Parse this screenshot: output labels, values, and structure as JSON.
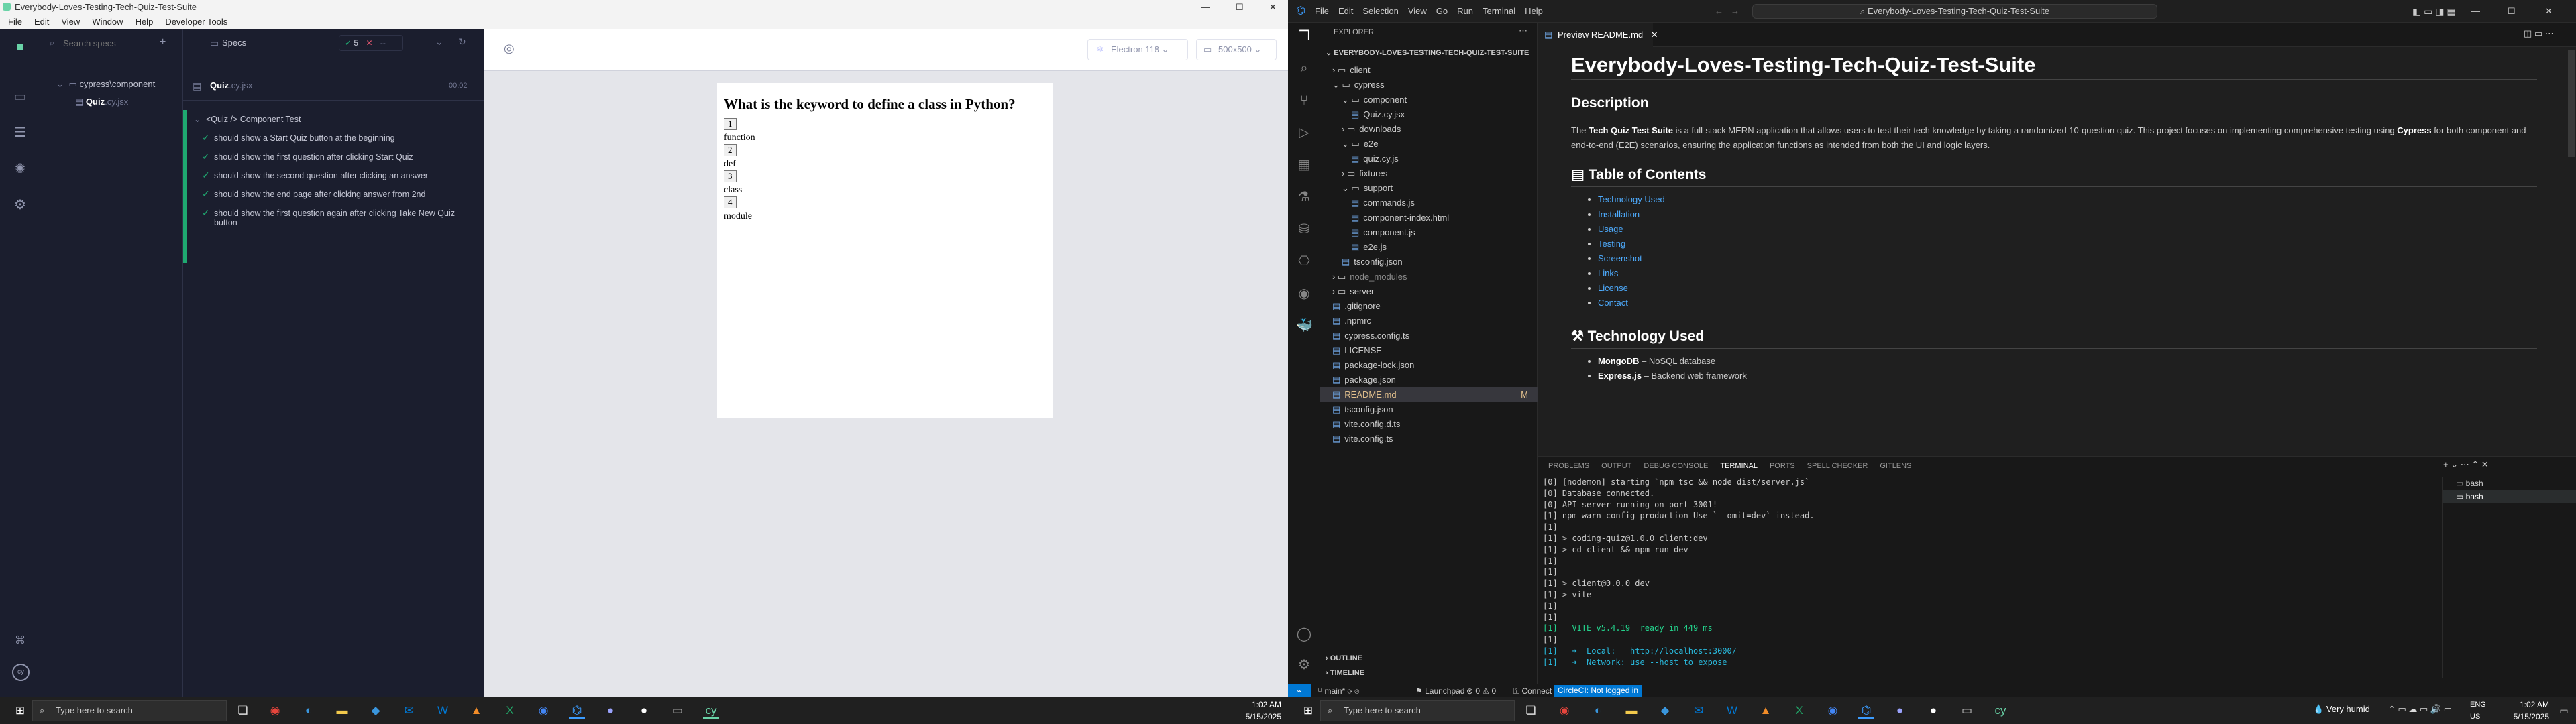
{
  "cypress": {
    "window_title": "Everybody-Loves-Testing-Tech-Quiz-Test-Suite",
    "menu": [
      "File",
      "Edit",
      "View",
      "Window",
      "Help",
      "Developer Tools"
    ],
    "specs_header": "Specs",
    "search_placeholder": "Search specs",
    "folder": "cypress\\component",
    "spec_file": "Quiz",
    "spec_ext": ".cy.jsx",
    "pass_count": "5",
    "fail_count": "✕",
    "pending": "--",
    "runner_spec_name": "Quiz",
    "runner_spec_ext": ".cy.jsx",
    "duration": "00:02",
    "suite": "<Quiz /> Component Test",
    "tests": [
      "should show a Start Quiz button at the beginning",
      "should show the first question after clicking Start Quiz",
      "should show the second question after clicking an answer",
      "should show the end page after clicking answer from 2nd",
      "should show the first question again after clicking Take New Quiz button"
    ],
    "browser": "Electron 118",
    "viewport": "500x500",
    "question": "What is the keyword to define a class in Python?",
    "answers": [
      {
        "num": "1",
        "text": "function"
      },
      {
        "num": "2",
        "text": "def"
      },
      {
        "num": "3",
        "text": "class"
      },
      {
        "num": "4",
        "text": "module"
      }
    ]
  },
  "vscode": {
    "menu": [
      "File",
      "Edit",
      "Selection",
      "View",
      "Go",
      "Run",
      "Terminal",
      "Help"
    ],
    "search": "Everybody-Loves-Testing-Tech-Quiz-Test-Suite",
    "explorer_title": "EXPLORER",
    "project": "EVERYBODY-LOVES-TESTING-TECH-QUIZ-TEST-SUITE",
    "tree": [
      {
        "label": "client",
        "depth": 1,
        "type": "folder"
      },
      {
        "label": "cypress",
        "depth": 1,
        "type": "folder-open"
      },
      {
        "label": "component",
        "depth": 2,
        "type": "folder-open"
      },
      {
        "label": "Quiz.cy.jsx",
        "depth": 3,
        "type": "file"
      },
      {
        "label": "downloads",
        "depth": 2,
        "type": "folder"
      },
      {
        "label": "e2e",
        "depth": 2,
        "type": "folder-open"
      },
      {
        "label": "quiz.cy.js",
        "depth": 3,
        "type": "file"
      },
      {
        "label": "fixtures",
        "depth": 2,
        "type": "folder"
      },
      {
        "label": "support",
        "depth": 2,
        "type": "folder-open"
      },
      {
        "label": "commands.js",
        "depth": 3,
        "type": "file"
      },
      {
        "label": "component-index.html",
        "depth": 3,
        "type": "file"
      },
      {
        "label": "component.js",
        "depth": 3,
        "type": "file"
      },
      {
        "label": "e2e.js",
        "depth": 3,
        "type": "file"
      },
      {
        "label": "tsconfig.json",
        "depth": 2,
        "type": "file"
      },
      {
        "label": "node_modules",
        "depth": 1,
        "type": "folder"
      },
      {
        "label": "server",
        "depth": 1,
        "type": "folder"
      },
      {
        "label": ".gitignore",
        "depth": 1,
        "type": "file"
      },
      {
        "label": ".npmrc",
        "depth": 1,
        "type": "file"
      },
      {
        "label": "cypress.config.ts",
        "depth": 1,
        "type": "file"
      },
      {
        "label": "LICENSE",
        "depth": 1,
        "type": "file"
      },
      {
        "label": "package-lock.json",
        "depth": 1,
        "type": "file"
      },
      {
        "label": "package.json",
        "depth": 1,
        "type": "file"
      },
      {
        "label": "README.md",
        "depth": 1,
        "type": "file",
        "selected": true,
        "badge": "M"
      },
      {
        "label": "tsconfig.json",
        "depth": 1,
        "type": "file"
      },
      {
        "label": "vite.config.d.ts",
        "depth": 1,
        "type": "file"
      },
      {
        "label": "vite.config.ts",
        "depth": 1,
        "type": "file"
      }
    ],
    "outline": "OUTLINE",
    "timeline": "TIMELINE",
    "tab": "Preview README.md",
    "readme": {
      "title": "Everybody-Loves-Testing-Tech-Quiz-Test-Suite",
      "h_desc": "Description",
      "desc_pre": "The ",
      "desc_bold1": "Tech Quiz Test Suite",
      "desc_mid": " is a full-stack MERN application that allows users to test their tech knowledge by taking a randomized 10-question quiz. This project focuses on implementing comprehensive testing using ",
      "desc_bold2": "Cypress",
      "desc_post": " for both component and end-to-end (E2E) scenarios, ensuring the application functions as intended from both the UI and logic layers.",
      "h_toc": "Table of Contents",
      "toc": [
        "Technology Used",
        "Installation",
        "Usage",
        "Testing",
        "Screenshot",
        "Links",
        "License",
        "Contact"
      ],
      "h_tech": "Technology Used",
      "tech": [
        {
          "name": "MongoDB",
          "desc": " – NoSQL database"
        },
        {
          "name": "Express.js",
          "desc": " – Backend web framework"
        }
      ]
    },
    "panel_tabs": [
      "PROBLEMS",
      "OUTPUT",
      "DEBUG CONSOLE",
      "TERMINAL",
      "PORTS",
      "SPELL CHECKER",
      "GITLENS"
    ],
    "terminal_lines": [
      "[0] [nodemon] starting `npm tsc && node dist/server.js`",
      "[0] Database connected.",
      "[0] API server running on port 3001!",
      "[1] npm warn config production Use `--omit=dev` instead.",
      "[1]",
      "[1] > coding-quiz@1.0.0 client:dev",
      "[1] > cd client && npm run dev",
      "[1]",
      "[1]",
      "[1] > client@0.0.0 dev",
      "[1] > vite",
      "[1]",
      "[1]",
      "[1]   VITE v5.4.19  ready in 449 ms",
      "[1]",
      "[1]   ➜  Local:   http://localhost:3000/",
      "[1]   ➜  Network: use --host to expose"
    ],
    "terminals": [
      "bash",
      "bash"
    ],
    "status": {
      "branch": "main*",
      "launch": "Launchpad",
      "problems": "0 ⚠ 0",
      "connect": "Connect",
      "circleci": "CircleCI: Not logged in"
    }
  },
  "taskbar": {
    "search_placeholder": "Type here to search",
    "time": "1:02 AM",
    "date": "5/15/2025",
    "weather": "Very humid",
    "lang1": "ENG",
    "lang2": "US"
  },
  "colors": {
    "cypress_bg": "#1b1e2e",
    "pass": "#1fa971",
    "vs_bg": "#1e1e1e",
    "link": "#4daafc",
    "accent": "#0078d4"
  }
}
